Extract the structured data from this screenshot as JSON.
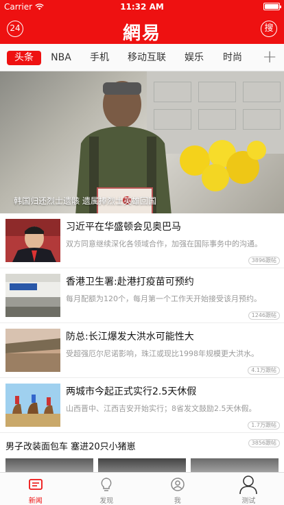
{
  "status_bar": {
    "carrier": "Carrier",
    "time": "11:32 AM",
    "battery_level": 1.0
  },
  "nav": {
    "left_icon_text": "24",
    "logo": "網易",
    "right_icon_text": "搜"
  },
  "tabs": [
    {
      "label": "头条",
      "active": true
    },
    {
      "label": "NBA",
      "active": false
    },
    {
      "label": "手机",
      "active": false
    },
    {
      "label": "移动互联",
      "active": false
    },
    {
      "label": "娱乐",
      "active": false
    },
    {
      "label": "时尚",
      "active": false
    }
  ],
  "add_tab_icon": "plus-icon",
  "hero": {
    "caption": "韩国归还烈士遗骸 遗属捧烈士英雄回国"
  },
  "news": [
    {
      "title": "习近平在华盛顿会见奥巴马",
      "digest": "双方同意继续深化各领域合作，加强在国际事务中的沟通。",
      "badge": "3896跟帖"
    },
    {
      "title": "香港卫生署:赴港打疫苗可预约",
      "digest": "每月配额为120个，每月第一个工作天开始接受该月预约。",
      "badge": "1246跟帖"
    },
    {
      "title": "防总:长江爆发大洪水可能性大",
      "digest": "受超强厄尔尼诺影响，珠江或现比1998年规模更大洪水。",
      "badge": "4.1万跟帖"
    },
    {
      "title": "两城市今起正式实行2.5天休假",
      "digest": "山西晋中、江西吉安开始实行；8省发文鼓励2.5天休假。",
      "badge": "1.7万跟帖"
    }
  ],
  "big_item": {
    "title": "男子改装面包车 塞进20只小猪崽",
    "badge": "3856跟帖"
  },
  "tabbar": [
    {
      "label": "新闻",
      "icon": "news-icon",
      "active": true
    },
    {
      "label": "发现",
      "icon": "bulb-icon",
      "active": false
    },
    {
      "label": "我",
      "icon": "user-icon",
      "active": false
    },
    {
      "label": "测试",
      "icon": "person-icon",
      "active": false
    }
  ],
  "colors": {
    "brand": "#ee1111",
    "tab_text": "#333333",
    "digest": "#9a9a9a"
  }
}
